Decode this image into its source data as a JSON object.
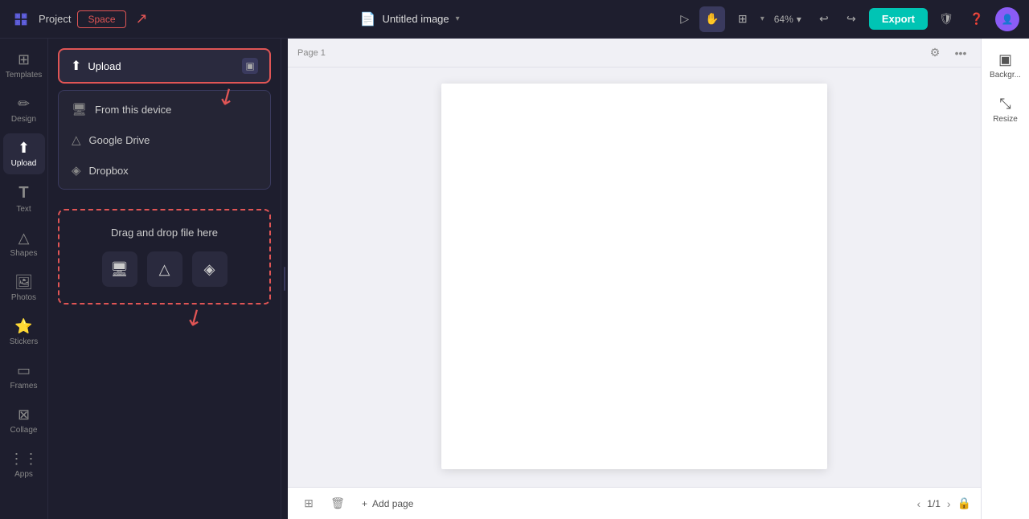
{
  "header": {
    "project_label": "Project",
    "space_label": "Space",
    "doc_title": "Untitled image",
    "zoom_level": "64%",
    "export_label": "Export"
  },
  "icon_bar": {
    "items": [
      {
        "id": "templates",
        "label": "Templates",
        "icon": "⊞"
      },
      {
        "id": "design",
        "label": "Design",
        "icon": "✏️"
      },
      {
        "id": "upload",
        "label": "Upload",
        "icon": "⬆"
      },
      {
        "id": "text",
        "label": "Text",
        "icon": "T"
      },
      {
        "id": "shapes",
        "label": "Shapes",
        "icon": "△"
      },
      {
        "id": "photos",
        "label": "Photos",
        "icon": "🖼"
      },
      {
        "id": "stickers",
        "label": "Stickers",
        "icon": "⭐"
      },
      {
        "id": "frames",
        "label": "Frames",
        "icon": "▭"
      },
      {
        "id": "collage",
        "label": "Collage",
        "icon": "⊠"
      },
      {
        "id": "apps",
        "label": "Apps",
        "icon": "⋮⋮"
      }
    ]
  },
  "upload_panel": {
    "upload_btn_label": "Upload",
    "dropdown_items": [
      {
        "id": "device",
        "label": "From this device",
        "icon": "🖥"
      },
      {
        "id": "google_drive",
        "label": "Google Drive",
        "icon": "△"
      },
      {
        "id": "dropbox",
        "label": "Dropbox",
        "icon": "◈"
      }
    ],
    "drag_drop_text": "Drag and drop file here"
  },
  "canvas": {
    "page_label": "Page 1"
  },
  "bottom_bar": {
    "add_page_label": "Add page",
    "page_count": "1/1"
  },
  "right_sidebar": {
    "items": [
      {
        "id": "background",
        "label": "Backgr...",
        "icon": "▣"
      },
      {
        "id": "resize",
        "label": "Resize",
        "icon": "⤡"
      }
    ]
  }
}
